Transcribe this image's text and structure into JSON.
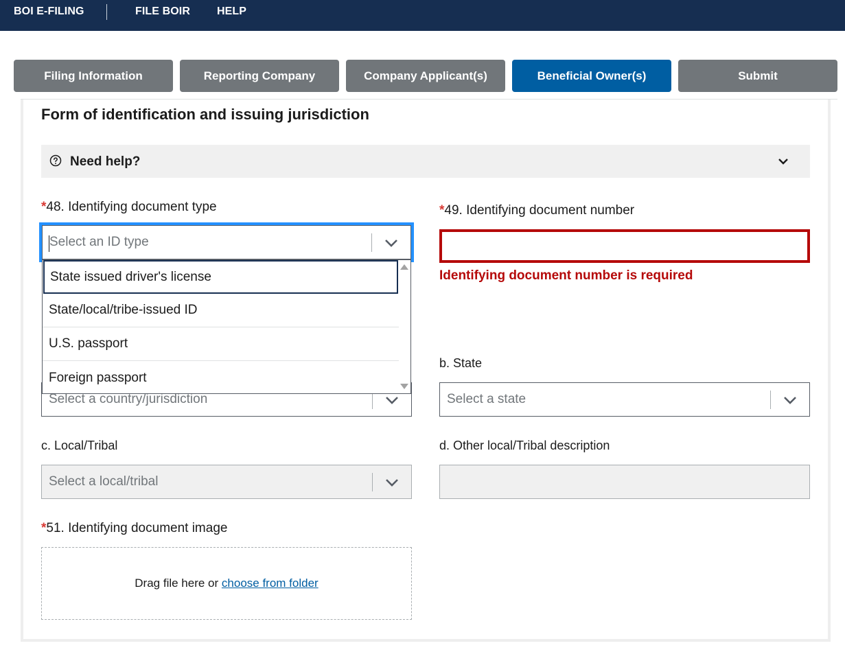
{
  "nav": {
    "brand": "BOI E-FILING",
    "items": [
      "FILE BOIR",
      "HELP"
    ]
  },
  "steps": [
    {
      "label": "Filing Information",
      "active": false
    },
    {
      "label": "Reporting Company",
      "active": false
    },
    {
      "label": "Company Applicant(s)",
      "active": false
    },
    {
      "label": "Beneficial Owner(s)",
      "active": true
    },
    {
      "label": "Submit",
      "active": false
    }
  ],
  "section": {
    "title": "Form of identification and issuing jurisdiction",
    "help_label": "Need help?"
  },
  "fields": {
    "doc_type": {
      "required_mark": "*",
      "label": "48. Identifying document type",
      "placeholder": "Select an ID type",
      "options": [
        "State issued driver's license",
        "State/local/tribe-issued ID",
        "U.S. passport",
        "Foreign passport"
      ]
    },
    "doc_number": {
      "required_mark": "*",
      "label": "49. Identifying document number",
      "value": "",
      "error": "Identifying document number is required"
    },
    "country": {
      "placeholder": "Select a country/jurisdiction"
    },
    "state": {
      "label": "b. State",
      "placeholder": "Select a state"
    },
    "local_tribal": {
      "label": "c. Local/Tribal",
      "placeholder": "Select a local/tribal"
    },
    "other_local": {
      "label": "d. Other local/Tribal description",
      "value": ""
    },
    "doc_image": {
      "required_mark": "*",
      "label": "51. Identifying document image",
      "drop_text": "Drag file here or ",
      "drop_link": "choose from folder"
    }
  },
  "colors": {
    "nav_bg": "#162e51",
    "step_inactive": "#71767a",
    "step_active": "#005ea2",
    "error": "#b50909",
    "focus": "#2491ff",
    "link": "#005ea2"
  }
}
